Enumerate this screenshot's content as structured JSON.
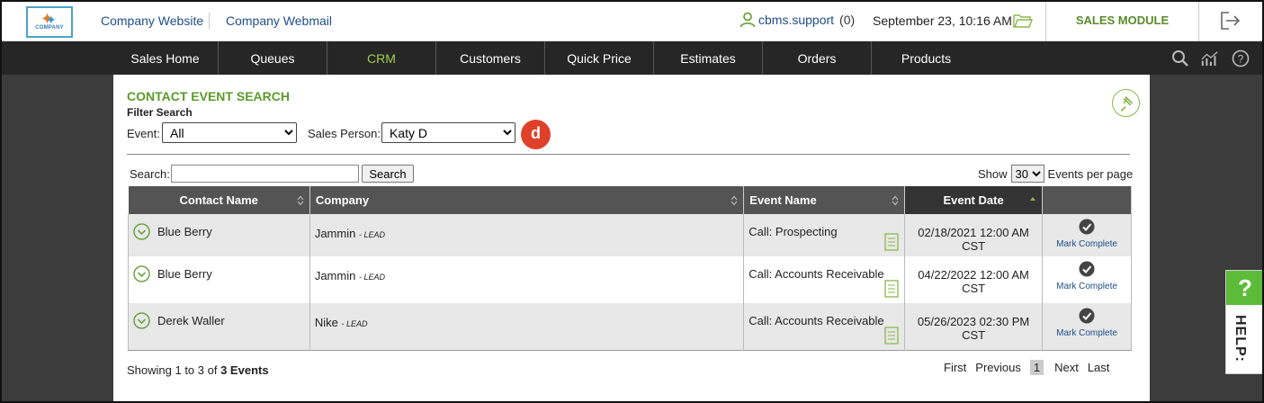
{
  "header": {
    "logo_text": "COMPANY",
    "link_website": "Company Website",
    "link_webmail": "Company Webmail",
    "username": "cbms.support",
    "notif_count": "(0)",
    "datetime": "September 23, 10:16 AM",
    "module": "SALES MODULE",
    "icons": [
      "user-icon",
      "folder-icon",
      "logout-icon"
    ]
  },
  "nav": {
    "items": [
      "Sales Home",
      "Queues",
      "CRM",
      "Customers",
      "Quick Price",
      "Estimates",
      "Orders",
      "Products"
    ],
    "active": "CRM",
    "icons": [
      "search-icon",
      "chart-icon",
      "help-icon"
    ]
  },
  "page": {
    "title": "CONTACT EVENT SEARCH",
    "subtitle": "Filter Search",
    "event_label": "Event:",
    "event_value": "All",
    "sales_label": "Sales Person:",
    "sales_value": "Katy D",
    "badge": "d",
    "search_label": "Search:",
    "search_value": "",
    "search_button": "Search",
    "show_label": "Show",
    "per_page": "30",
    "per_page_label": "Events per page"
  },
  "table": {
    "headers": [
      "Contact Name",
      "Company",
      "Event Name",
      "Event Date",
      ""
    ],
    "rows": [
      {
        "contact": "Blue Berry",
        "company": "Jammin",
        "tag": "- LEAD",
        "event": "Call: Prospecting",
        "date1": "02/18/2021 12:00 AM",
        "date2": "CST",
        "action": "Mark Complete"
      },
      {
        "contact": "Blue Berry",
        "company": "Jammin",
        "tag": "- LEAD",
        "event": "Call: Accounts Receivable",
        "date1": "04/22/2022 12:00 AM",
        "date2": "CST",
        "action": "Mark Complete"
      },
      {
        "contact": "Derek Waller",
        "company": "Nike",
        "tag": "- LEAD",
        "event": "Call: Accounts Receivable",
        "date1": "05/26/2023 02:30 PM",
        "date2": "CST",
        "action": "Mark Complete"
      }
    ]
  },
  "footer": {
    "showing": "Showing 1 to 3 of",
    "total": "3 Events",
    "pager": {
      "first": "First",
      "previous": "Previous",
      "current": "1",
      "next": "Next",
      "last": "Last"
    }
  },
  "help": {
    "q": "?",
    "label": "HELP:"
  },
  "colors": {
    "accent_green": "#5a9a2a",
    "nav_bg": "#262626",
    "link_blue": "#1f4e8a",
    "badge_red": "#e0402a"
  }
}
